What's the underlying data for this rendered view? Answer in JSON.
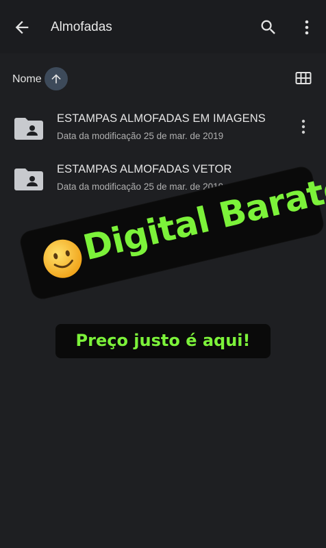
{
  "appbar": {
    "title": "Almofadas",
    "back_icon": "arrow-back-icon",
    "search_icon": "search-icon",
    "more_icon": "more-vert-icon"
  },
  "sort": {
    "label": "Nome",
    "direction": "ascending",
    "sort_icon": "arrow-up-icon",
    "view_icon": "grid-view-icon"
  },
  "files": [
    {
      "name": "ESTAMPAS ALMOFADAS EM IMAGENS",
      "meta": "Data da modificação 25 de mar. de 2019",
      "icon": "shared-folder-icon"
    },
    {
      "name": "ESTAMPAS ALMOFADAS VETOR",
      "meta": "Data da modificação 25 de mar. de 2019",
      "icon": "shared-folder-icon"
    }
  ],
  "overlay": {
    "banner_text": "Digital Barato",
    "tagline": "Preço justo é aqui!",
    "emoji_icon": "smiling-face-icon",
    "accent_color": "#7cf23a"
  },
  "colors": {
    "background": "#1e1f22",
    "appbar": "#1b1c1f",
    "sort_button": "#3d4a5a"
  }
}
